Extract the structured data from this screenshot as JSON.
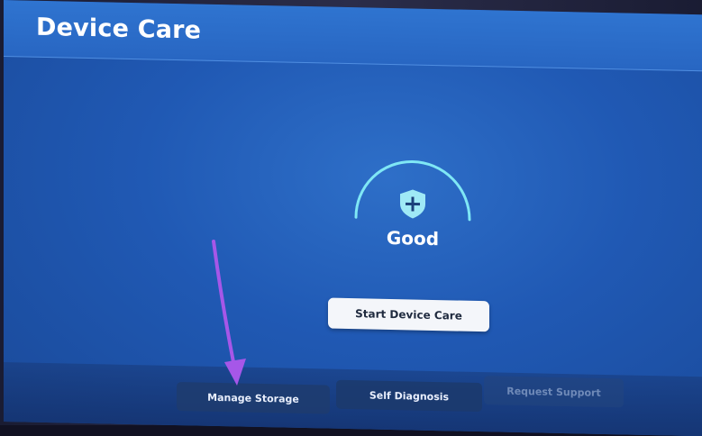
{
  "header": {
    "title": "Device Care"
  },
  "status": {
    "label": "Good",
    "icon": "shield-plus-icon",
    "ring_color": "#7fe7f5"
  },
  "actions": {
    "start_label": "Start Device Care"
  },
  "bottom_tabs": [
    {
      "label": "Manage Storage",
      "enabled": true
    },
    {
      "label": "Self Diagnosis",
      "enabled": true
    },
    {
      "label": "Request Support",
      "enabled": false
    }
  ],
  "annotation": {
    "icon": "arrow-down-icon",
    "color": "#a657e8"
  },
  "colors": {
    "screen_blue": "#2563be",
    "header_blue": "#2f74d0",
    "button_bg": "#f4f6fa"
  }
}
